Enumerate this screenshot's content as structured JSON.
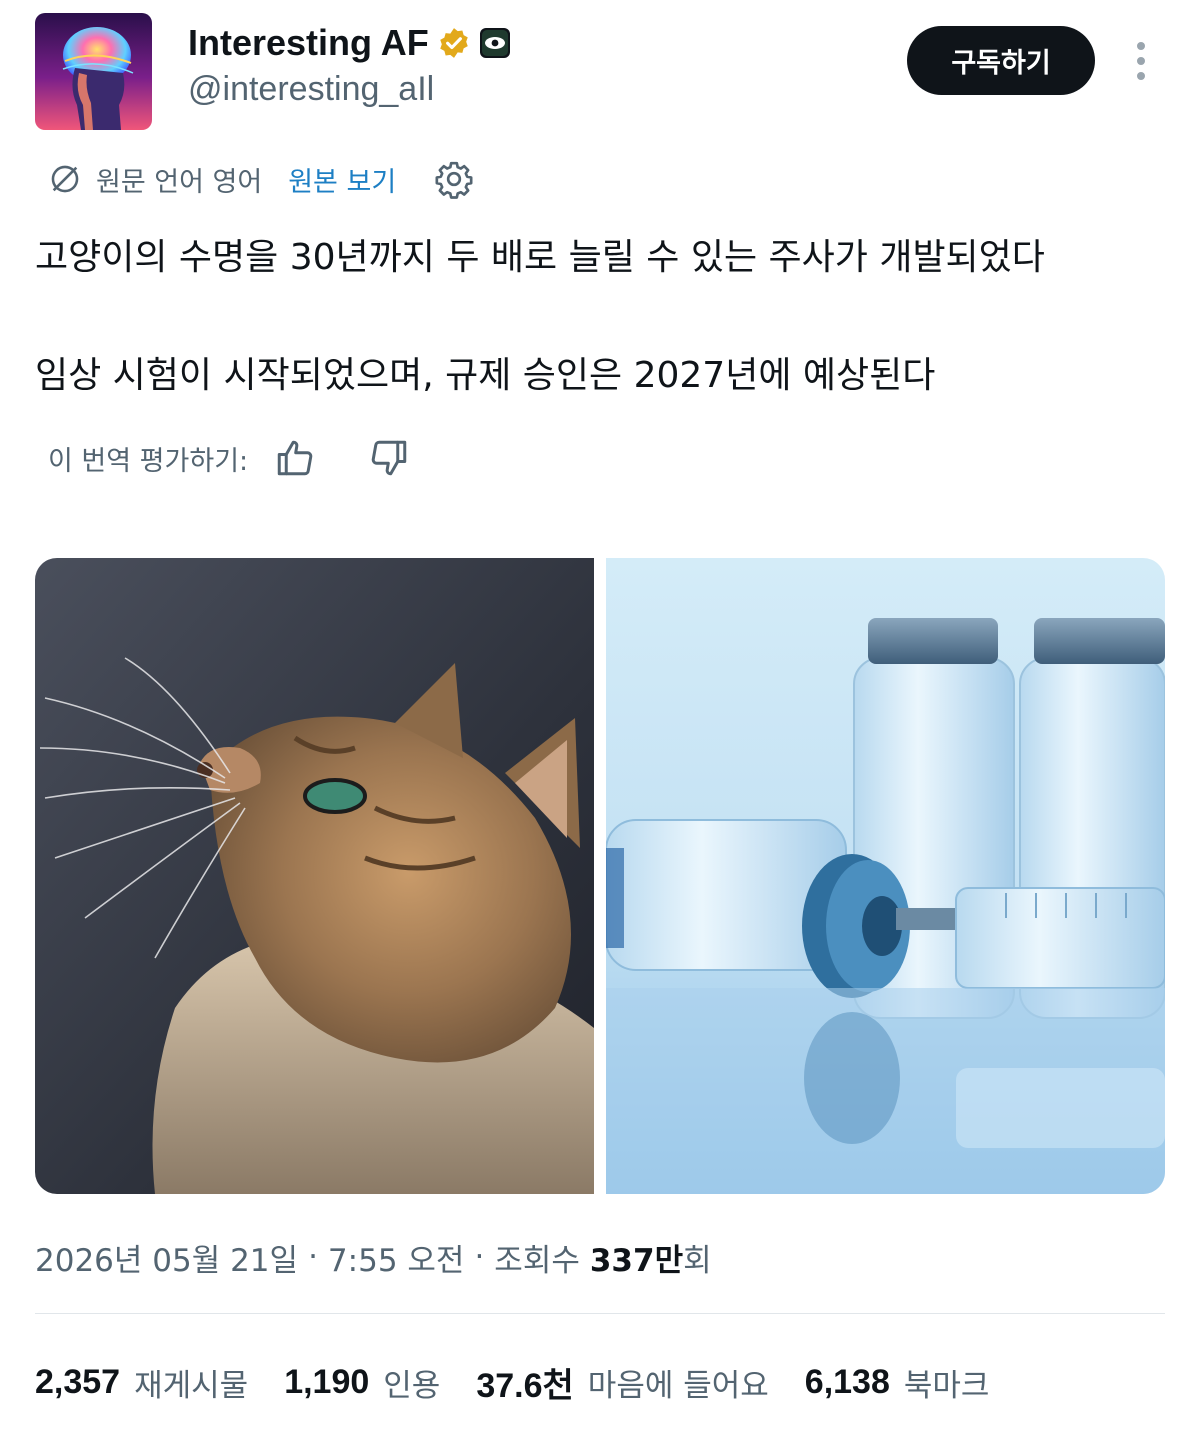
{
  "author": {
    "display_name": "Interesting AF",
    "handle": "@interesting_aIl",
    "verified_color": "#e2a91b",
    "avatar_icon": "neon-brain-head-icon",
    "affiliate_badge_icon": "eye-badge-icon"
  },
  "actions": {
    "subscribe_label": "구독하기",
    "more_icon": "more-vertical-icon"
  },
  "translation": {
    "icon": "translate-icon",
    "language_note": "원문 언어 영어",
    "view_original_label": "원본 보기",
    "settings_icon": "gear-icon",
    "rate_prompt": "이 번역 평가하기:",
    "thumbs_up_icon": "thumbs-up-icon",
    "thumbs_down_icon": "thumbs-down-icon"
  },
  "tweet": {
    "line1": "고양이의 수명을 30년까지 두 배로 늘릴 수 있는 주사가 개발되었다",
    "line2": "임상 시험이 시작되었으며, 규제 승인은 2027년에 예상된다"
  },
  "media": [
    {
      "name": "cat-photo"
    },
    {
      "name": "vaccine-vials-photo"
    }
  ],
  "meta": {
    "date": "2026년 05월 21일",
    "time": "7:55 오전",
    "views_label": "조회수",
    "views_num": "337만",
    "views_suffix": "회",
    "separator": "·"
  },
  "stats": [
    {
      "num": "2,357",
      "label": "재게시물"
    },
    {
      "num": "1,190",
      "label": "인용"
    },
    {
      "num": "37.6천",
      "label": "마음에 들어요"
    },
    {
      "num": "6,138",
      "label": "북마크"
    }
  ],
  "colors": {
    "text_primary": "#0f1419",
    "text_secondary": "#536471",
    "link": "#1d7fc4",
    "button_bg": "#0f1419"
  }
}
